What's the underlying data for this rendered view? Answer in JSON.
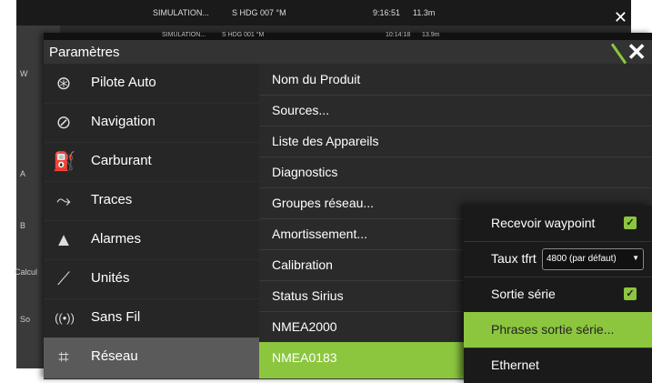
{
  "background_screen": {
    "status_left": "SIMULATION...",
    "status_hdg": "S HDG 007 °M",
    "status_time": "9:16:51",
    "status_depth": "11.3m",
    "side_labels": [
      "W",
      "A",
      "B",
      "Calcul",
      "So"
    ]
  },
  "window": {
    "strip_sim": "SIMULATION...",
    "strip_hdg": "S HDG 001 °M",
    "strip_time": "10:14:18",
    "strip_depth": "13.9m",
    "title": "Paramètres",
    "close_label": "✕"
  },
  "left_menu": [
    {
      "label": "Pilote Auto",
      "icon": "autopilot-wheel-icon",
      "glyph": "⊛"
    },
    {
      "label": "Navigation",
      "icon": "compass-icon",
      "glyph": "⊘"
    },
    {
      "label": "Carburant",
      "icon": "fuel-pump-icon",
      "glyph": "⛽"
    },
    {
      "label": "Traces",
      "icon": "trail-icon",
      "glyph": "⤳"
    },
    {
      "label": "Alarmes",
      "icon": "bell-icon",
      "glyph": "▲"
    },
    {
      "label": "Unités",
      "icon": "ruler-icon",
      "glyph": "⟋"
    },
    {
      "label": "Sans Fil",
      "icon": "wireless-icon",
      "glyph": "((•))"
    },
    {
      "label": "Réseau",
      "icon": "network-icon",
      "glyph": "⌗"
    }
  ],
  "left_selected": 7,
  "middle_list": [
    "Nom du Produit",
    "Sources...",
    "Liste des Appareils",
    "Diagnostics",
    "Groupes réseau...",
    "Amortissement...",
    "Calibration",
    "Status Sirius",
    "NMEA2000",
    "NMEA0183"
  ],
  "middle_selected": 9,
  "popup": {
    "recevoir_label": "Recevoir waypoint",
    "recevoir_checked": true,
    "taux_label": "Taux tfrt",
    "taux_value": "4800 (par défaut)",
    "sortie_label": "Sortie série",
    "sortie_checked": true,
    "phrases_label": "Phrases sortie série...",
    "ethernet_label": "Ethernet"
  },
  "colors": {
    "accent": "#8cc63f",
    "panel": "#262626"
  }
}
